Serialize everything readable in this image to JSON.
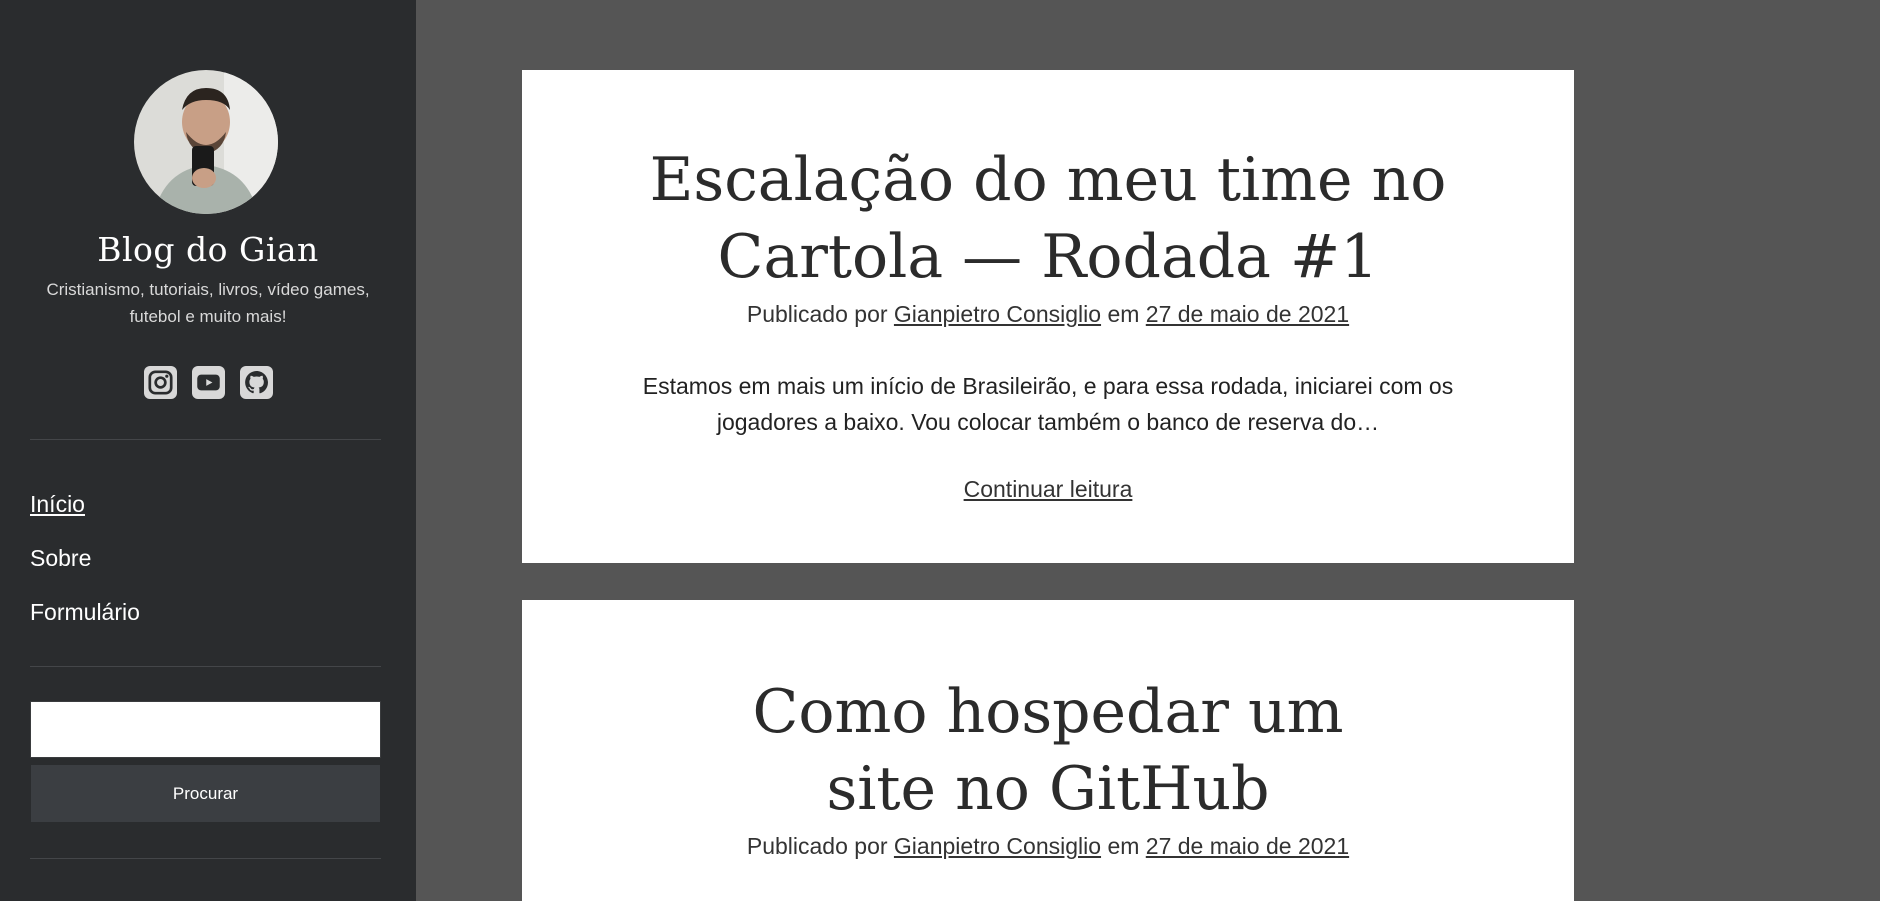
{
  "sidebar": {
    "site_title": "Blog do Gian",
    "site_description": "Cristianismo, tutoriais, livros, vídeo games, futebol e muito mais!",
    "social_icons": [
      "instagram-icon",
      "youtube-icon",
      "github-icon"
    ],
    "nav": [
      {
        "label": "Início",
        "active": true
      },
      {
        "label": "Sobre",
        "active": false
      },
      {
        "label": "Formulário",
        "active": false
      }
    ],
    "search": {
      "value": "",
      "placeholder": "",
      "button_label": "Procurar"
    }
  },
  "posts": [
    {
      "title": "Escalação do meu time no Cartola — Rodada #1",
      "meta_prefix": "Publicado por",
      "author": "Gianpietro Consiglio",
      "meta_middle": "em",
      "date": "27 de maio de 2021",
      "excerpt": "Estamos em mais um início de Brasileirão, e para essa rodada, iniciarei com os jogadores a baixo. Vou colocar também o banco de reserva do…",
      "continue_label": "Continuar leitura"
    },
    {
      "title": "Como hospedar um site no GitHub",
      "meta_prefix": "Publicado por",
      "author": "Gianpietro Consiglio",
      "meta_middle": "em",
      "date": "27 de maio de 2021"
    }
  ],
  "colors": {
    "sidebar_bg": "#2a2c2e",
    "page_bg": "#555555",
    "card_bg": "#ffffff",
    "button_bg": "#3b3e42"
  }
}
